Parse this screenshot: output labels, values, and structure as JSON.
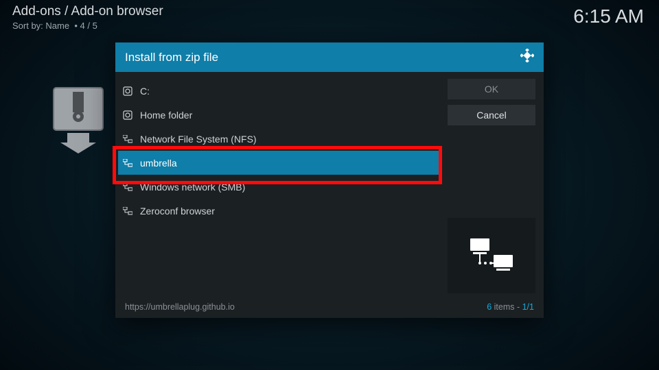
{
  "header": {
    "breadcrumb": "Add-ons / Add-on browser",
    "sort_label": "Sort by:",
    "sort_value": "Name",
    "sort_sep": "•",
    "page_pos": "4 / 5"
  },
  "clock": "6:15 AM",
  "dialog": {
    "title": "Install from zip file",
    "buttons": {
      "ok": "OK",
      "cancel": "Cancel"
    },
    "items": [
      {
        "label": "C:",
        "icon": "disk",
        "selected": false
      },
      {
        "label": "Home folder",
        "icon": "disk",
        "selected": false
      },
      {
        "label": "Network File System (NFS)",
        "icon": "net",
        "selected": false
      },
      {
        "label": "umbrella",
        "icon": "net",
        "selected": true
      },
      {
        "label": "Windows network (SMB)",
        "icon": "net",
        "selected": false
      },
      {
        "label": "Zeroconf browser",
        "icon": "net",
        "selected": false
      }
    ],
    "footer_path": "https://umbrellaplug.github.io",
    "footer_items_count": "6",
    "footer_items_word": " items",
    "footer_items_sep": " - ",
    "footer_page": "1/1"
  }
}
